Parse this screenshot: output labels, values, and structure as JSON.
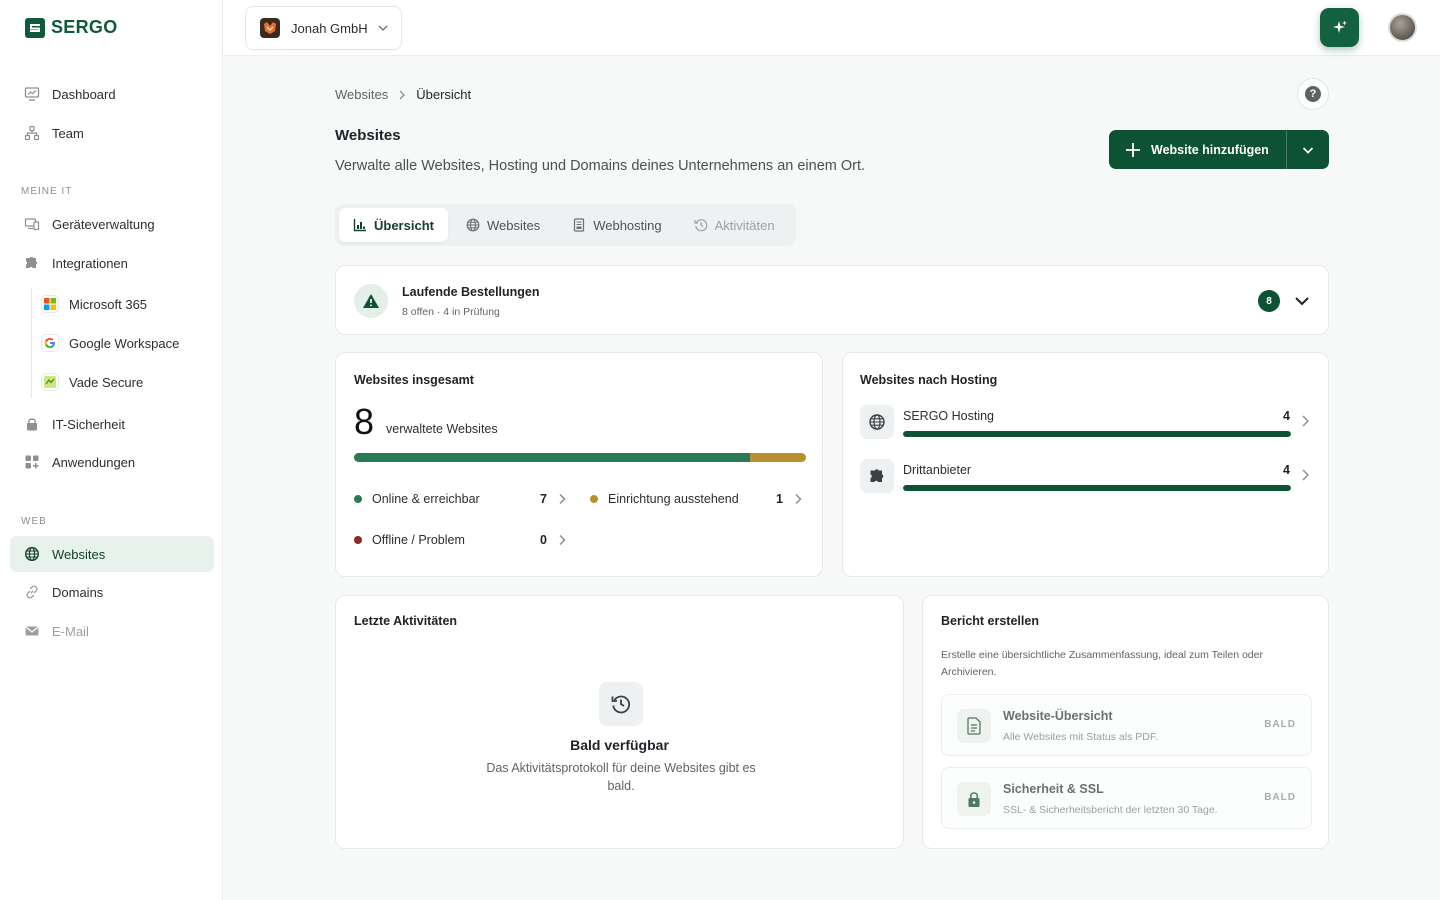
{
  "brand": {
    "name": "SERGO",
    "accent": "#0e5234"
  },
  "sidebar": {
    "main": [
      {
        "label": "Dashboard",
        "icon": "monitor-chart-icon"
      },
      {
        "label": "Team",
        "icon": "org-chart-icon"
      }
    ],
    "section_meine_it": "MEINE IT",
    "meine_it": [
      {
        "label": "Geräteverwaltung",
        "icon": "devices-icon"
      },
      {
        "label": "Integrationen",
        "icon": "puzzle-icon"
      }
    ],
    "integrations": [
      {
        "label": "Microsoft 365",
        "icon": "microsoft-logo-icon"
      },
      {
        "label": "Google Workspace",
        "icon": "google-logo-icon"
      },
      {
        "label": "Vade Secure",
        "icon": "vade-logo-icon"
      }
    ],
    "more": [
      {
        "label": "IT-Sicherheit",
        "icon": "lock-icon"
      },
      {
        "label": "Anwendungen",
        "icon": "apps-grid-icon"
      }
    ],
    "section_web": "WEB",
    "web": [
      {
        "label": "Websites",
        "icon": "globe-icon",
        "active": true
      },
      {
        "label": "Domains",
        "icon": "link-icon"
      },
      {
        "label": "E-Mail",
        "icon": "mail-icon",
        "disabled": true
      }
    ]
  },
  "topbar": {
    "org_name": "Jonah GmbH"
  },
  "breadcrumb": {
    "parent": "Websites",
    "current": "Übersicht"
  },
  "header": {
    "title": "Websites",
    "subtitle": "Verwalte alle Websites, Hosting und Domains deines Unternehmens an einem Ort.",
    "add_button": "Website hinzufügen"
  },
  "tabs": [
    {
      "label": "Übersicht",
      "icon": "bar-chart-icon",
      "active": true
    },
    {
      "label": "Websites",
      "icon": "globe-icon"
    },
    {
      "label": "Webhosting",
      "icon": "server-doc-icon"
    },
    {
      "label": "Aktivitäten",
      "icon": "history-icon",
      "disabled": true
    }
  ],
  "orders": {
    "title": "Laufende Bestellungen",
    "summary": "8 offen · 4 in Prüfung",
    "count": "8"
  },
  "totals": {
    "title": "Websites insgesamt",
    "number": "8",
    "label": "verwaltete Websites",
    "progress": [
      {
        "fraction": 0.875,
        "color": "#2a7a55"
      },
      {
        "fraction": 0.125,
        "color": "#b8902f"
      }
    ],
    "stats": [
      {
        "label": "Online & erreichbar",
        "value": "7",
        "color": "#2a7a55"
      },
      {
        "label": "Einrichtung ausstehend",
        "value": "1",
        "color": "#b8902f"
      },
      {
        "label": "Offline / Problem",
        "value": "0",
        "color": "#8b2b2b"
      }
    ]
  },
  "hosting": {
    "title": "Websites nach Hosting",
    "rows": [
      {
        "label": "SERGO Hosting",
        "value": "4",
        "fraction": 1.0,
        "icon": "globe-icon"
      },
      {
        "label": "Drittanbieter",
        "value": "4",
        "fraction": 1.0,
        "icon": "puzzle-icon"
      }
    ]
  },
  "activities": {
    "title": "Letzte Aktivitäten",
    "empty_title": "Bald verfügbar",
    "empty_text": "Das Aktivitätsprotokoll für deine Websites gibt es bald."
  },
  "report": {
    "title": "Bericht erstellen",
    "description": "Erstelle eine übersichtliche Zusammenfassung, ideal zum Teilen oder Archivieren.",
    "items": [
      {
        "name": "Website-Übersicht",
        "desc": "Alle Websites mit Status als PDF.",
        "badge": "BALD",
        "icon": "document-icon"
      },
      {
        "name": "Sicherheit & SSL",
        "desc": "SSL- & Sicherheitsbericht der letzten 30 Tage.",
        "badge": "BALD",
        "icon": "lock-icon"
      }
    ]
  }
}
